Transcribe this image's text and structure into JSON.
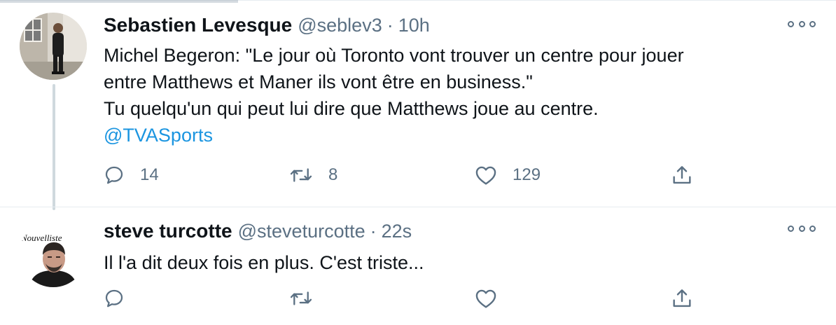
{
  "tweets": [
    {
      "display_name": "Sebastien Levesque",
      "handle": "@seblev3",
      "separator": "·",
      "time": "10h",
      "text_lines": [
        "Michel Begeron: \"Le jour où Toronto vont trouver un centre pour jouer",
        "entre Matthews et Maner ils vont être en business.\"",
        "Tu quelqu'un qui peut lui dire que Matthews joue au centre."
      ],
      "mention": "@TVASports",
      "replies": "14",
      "retweets": "8",
      "likes": "129",
      "avatar_icon": "person-standing-photo"
    },
    {
      "display_name": "steve turcotte",
      "handle": "@steveturcotte",
      "separator": "·",
      "time": "22s",
      "text_lines": [
        "Il l'a dit deux fois en plus. C'est triste..."
      ],
      "avatar_logo_text": "Nouvelliste",
      "avatar_icon": "person-headshot-photo"
    }
  ],
  "icons": {
    "reply": "reply-icon",
    "retweet": "retweet-icon",
    "like": "heart-icon",
    "share": "share-icon",
    "more": "more-icon"
  },
  "colors": {
    "text": "#0f1419",
    "secondary": "#5b7083",
    "mention": "#1b95e0",
    "divider": "#e6ecf0",
    "thread_line": "#cfd9de"
  }
}
